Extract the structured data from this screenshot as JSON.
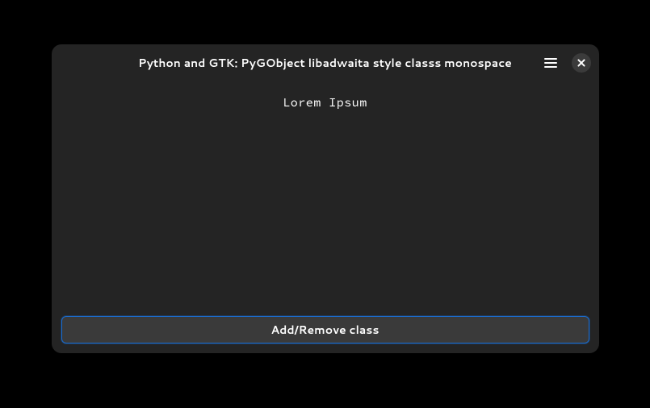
{
  "window": {
    "title": "Python and GTK: PyGObject libadwaita style classs monospace"
  },
  "content": {
    "text": "Lorem Ipsum"
  },
  "button": {
    "label": "Add/Remove class"
  }
}
